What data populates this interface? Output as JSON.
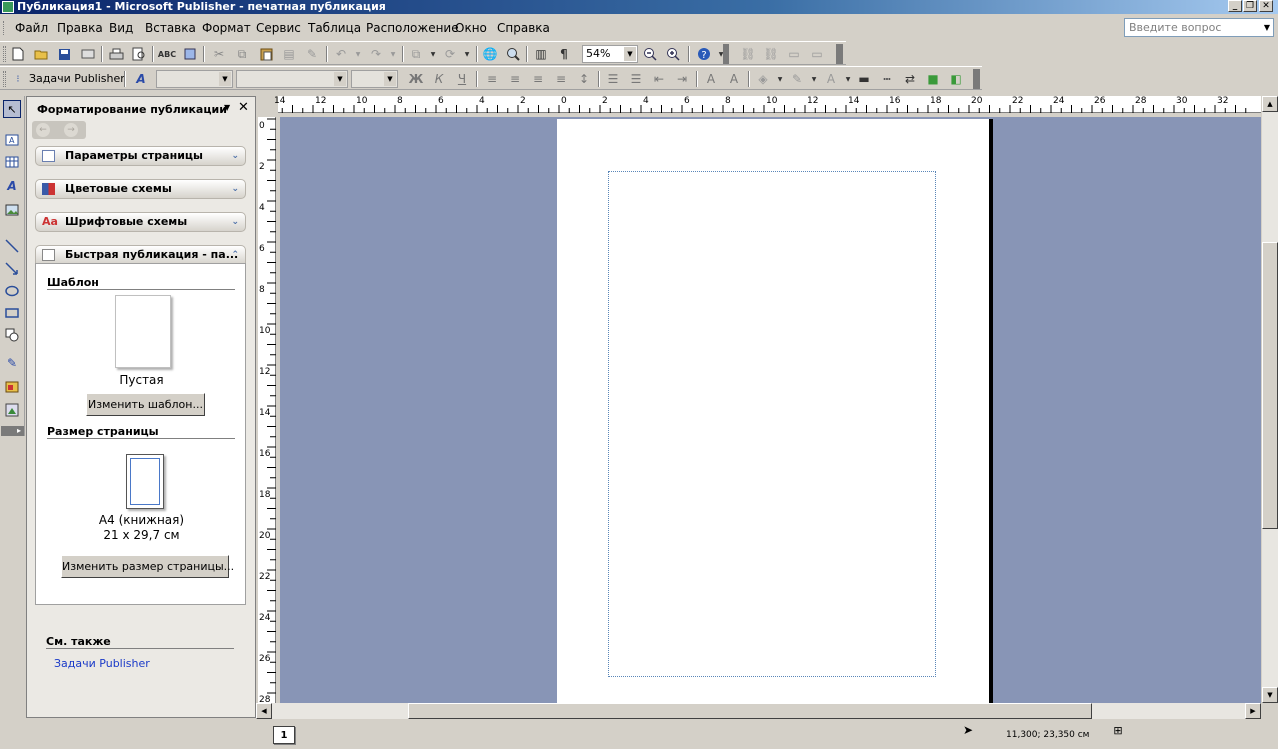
{
  "window": {
    "title": "Публикация1 - Microsoft Publisher - печатная публикация"
  },
  "menu": [
    "Файл",
    "Правка",
    "Вид",
    "Вставка",
    "Формат",
    "Сервис",
    "Таблица",
    "Расположение",
    "Окно",
    "Справка"
  ],
  "help_box": {
    "placeholder": "Введите вопрос"
  },
  "toolbar": {
    "zoom": "54%",
    "tasks_label": "Задачи Publisher"
  },
  "pane": {
    "title": "Форматирование публикации",
    "sections": [
      "Параметры страницы",
      "Цветовые схемы",
      "Шрифтовые схемы",
      "Быстрая публикация - па..."
    ],
    "template_heading": "Шаблон",
    "template_name": "Пустая",
    "change_template_button": "Изменить шаблон...",
    "page_size_heading": "Размер страницы",
    "page_size_name": "A4 (книжная)",
    "page_size_dims": "21 x 29,7 см",
    "change_size_button": "Изменить размер страницы...",
    "see_also_heading": "См. также",
    "see_also_link": "Задачи Publisher"
  },
  "ruler": {
    "horizontal": [
      "14",
      "12",
      "10",
      "8",
      "6",
      "4",
      "2",
      "0",
      "2",
      "4",
      "6",
      "8",
      "10",
      "12",
      "14",
      "16",
      "18",
      "20",
      "22",
      "24",
      "26",
      "28",
      "30",
      "32"
    ],
    "vertical": [
      "0",
      "2",
      "4",
      "6",
      "8",
      "10",
      "12",
      "14",
      "16",
      "18",
      "20",
      "22",
      "24",
      "26",
      "28"
    ]
  },
  "status": {
    "page": "1",
    "coords": "11,300; 23,350 см"
  }
}
